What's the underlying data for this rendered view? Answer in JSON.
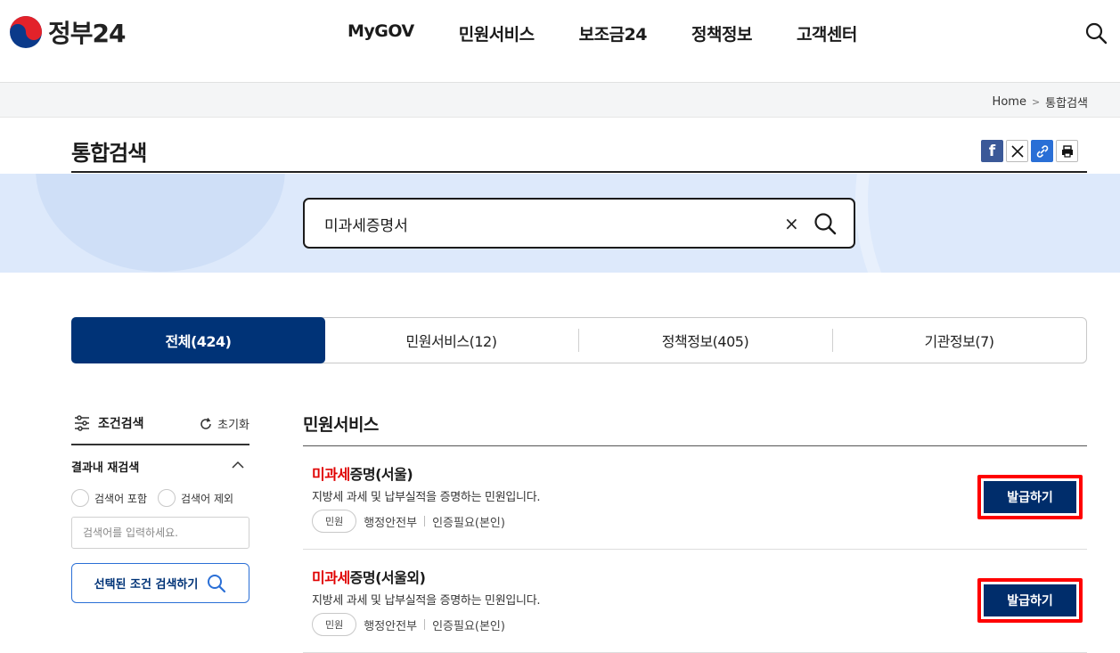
{
  "header": {
    "logo_text": "정부24",
    "nav": [
      "MyGOV",
      "민원서비스",
      "보조금24",
      "정책정보",
      "고객센터"
    ]
  },
  "breadcrumb": {
    "home": "Home",
    "current": "통합검색"
  },
  "page": {
    "title": "통합검색"
  },
  "search": {
    "value": "미과세증명서"
  },
  "tabs": [
    {
      "label": "전체(424)",
      "active": true
    },
    {
      "label": "민원서비스(12)",
      "active": false
    },
    {
      "label": "정책정보(405)",
      "active": false
    },
    {
      "label": "기관정보(7)",
      "active": false
    }
  ],
  "sidebar": {
    "condition_label": "조건검색",
    "reset_label": "초기화",
    "refine_title": "결과내 재검색",
    "include_label": "검색어 포함",
    "exclude_label": "검색어 제외",
    "input_placeholder": "검색어를 입력하세요.",
    "apply_label": "선택된 조건 검색하기"
  },
  "results": {
    "section_title": "민원서비스",
    "items": [
      {
        "title_highlight": "미과세",
        "title_rest": "증명(서울)",
        "description": "지방세 과세 및 납부실적을 증명하는 민원입니다.",
        "badge": "민원",
        "agency": "행정안전부",
        "auth": "인증필요(본인)",
        "button_label": "발급하기"
      },
      {
        "title_highlight": "미과세",
        "title_rest": "증명(서울외)",
        "description": "지방세 과세 및 납부실적을 증명하는 민원입니다.",
        "badge": "민원",
        "agency": "행정안전부",
        "auth": "인증필요(본인)",
        "button_label": "발급하기"
      }
    ]
  },
  "colors": {
    "primary": "#003377",
    "highlight": "#e00000",
    "annotation": "#ff0000",
    "banner": "#dde9fb"
  }
}
